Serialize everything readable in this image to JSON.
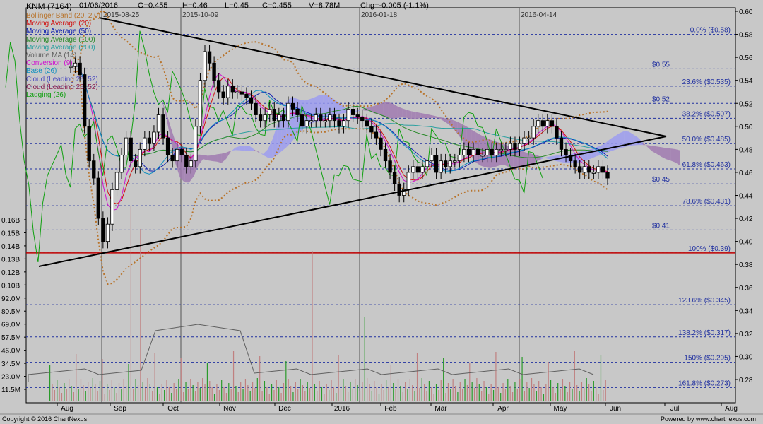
{
  "header": {
    "symbol": "KNM (7164)",
    "date": "01/06/2016",
    "open": "O=0.455",
    "high": "H=0.46",
    "low": "L=0.45",
    "close": "C=0.455",
    "volume": "V=8.78M",
    "change": "Chg=-0.005 (-1.1%)"
  },
  "legend": [
    {
      "label": "Bollinger Band (20, 2.0)",
      "color": "#b8732a"
    },
    {
      "label": "Moving Average (20)",
      "color": "#d01010"
    },
    {
      "label": "Moving Average (50)",
      "color": "#1020b0"
    },
    {
      "label": "Moving Average (100)",
      "color": "#2a8a2a"
    },
    {
      "label": "Moving Average (200)",
      "color": "#2aa0a0"
    },
    {
      "label": "Volume MA (14)",
      "color": "#606060"
    },
    {
      "label": "Conversion (9)",
      "color": "#d010d0"
    },
    {
      "label": "Base (26)",
      "color": "#1090c0"
    },
    {
      "label": "Cloud (Leading 26, 52)",
      "color": "#5050c0"
    },
    {
      "label": "Cloud (Leading 26, 52)",
      "color": "#8a2050"
    },
    {
      "label": "Lagging (26)",
      "color": "#10a010"
    }
  ],
  "footer": {
    "copyright": "Copyright © 2016 ChartNexus",
    "powered": "Powered by www.chartnexus.com"
  },
  "colors": {
    "background": "#c8c8c8",
    "candle_body": "#000000",
    "volume_up": "#2a9a2a",
    "volume_down": "#c08080",
    "support_line": "#c00000",
    "fib_line": "#2030a0",
    "cloud_bull": "#9c9cf0",
    "cloud_bear": "#a07ab0"
  },
  "chart_data": {
    "type": "candlestick",
    "price_axis": {
      "range": [
        0.265,
        0.6
      ],
      "ticks": [
        "0.60",
        "0.58",
        "0.56",
        "0.54",
        "0.52",
        "0.50",
        "0.48",
        "0.46",
        "0.44",
        "0.42",
        "0.40",
        "0.38",
        "0.36",
        "0.34",
        "0.32",
        "0.30",
        "0.28"
      ]
    },
    "volume_axis": {
      "ticks": [
        "0.16B",
        "0.15B",
        "0.14B",
        "0.13B",
        "0.12B",
        "0.10B",
        "92.0M",
        "80.5M",
        "69.0M",
        "57.5M",
        "46.0M",
        "34.5M",
        "23.0M",
        "11.5M"
      ]
    },
    "x_axis_labels": [
      "Aug",
      "Sep",
      "Oct",
      "Nov",
      "Dec",
      "2016",
      "Feb",
      "Mar",
      "Apr",
      "May",
      "Jun",
      "Jul",
      "Aug"
    ],
    "marker_dates": [
      "2015-08-25",
      "2015-10-09",
      "2016-01-18",
      "2016-04-14"
    ],
    "fibonacci_levels": [
      {
        "label": "0.0%  ($0.58)",
        "price": 0.58
      },
      {
        "label": "23.6%  ($0.535)",
        "price": 0.535
      },
      {
        "label": "38.2%  ($0.507)",
        "price": 0.507
      },
      {
        "label": "50.0%  ($0.485)",
        "price": 0.485
      },
      {
        "label": "61.8%  ($0.463)",
        "price": 0.463
      },
      {
        "label": "78.6%  ($0.431)",
        "price": 0.431
      },
      {
        "label": "100%  ($0.39)",
        "price": 0.39
      },
      {
        "label": "123.6%  ($0.345)",
        "price": 0.345
      },
      {
        "label": "138.2%  ($0.317)",
        "price": 0.317
      },
      {
        "label": "150%  ($0.295)",
        "price": 0.295
      },
      {
        "label": "161.8%  ($0.273)",
        "price": 0.273
      }
    ],
    "price_marks": [
      {
        "label": "$0.55",
        "price": 0.55
      },
      {
        "label": "$0.52",
        "price": 0.52
      },
      {
        "label": "$0.45",
        "price": 0.45
      },
      {
        "label": "$0.41",
        "price": 0.41
      }
    ],
    "support_level": 0.39,
    "closes": [
      0.552,
      0.555,
      0.545,
      0.5,
      0.47,
      0.455,
      0.42,
      0.4,
      0.415,
      0.445,
      0.46,
      0.475,
      0.49,
      0.47,
      0.465,
      0.48,
      0.49,
      0.485,
      0.495,
      0.51,
      0.49,
      0.475,
      0.47,
      0.48,
      0.475,
      0.465,
      0.47,
      0.5,
      0.54,
      0.565,
      0.555,
      0.54,
      0.53,
      0.525,
      0.535,
      0.53,
      0.53,
      0.528,
      0.525,
      0.52,
      0.51,
      0.505,
      0.51,
      0.515,
      0.505,
      0.51,
      0.505,
      0.52,
      0.515,
      0.51,
      0.5,
      0.505,
      0.505,
      0.51,
      0.505,
      0.505,
      0.51,
      0.505,
      0.5,
      0.505,
      0.515,
      0.51,
      0.508,
      0.505,
      0.5,
      0.495,
      0.49,
      0.48,
      0.47,
      0.46,
      0.45,
      0.44,
      0.445,
      0.46,
      0.465,
      0.46,
      0.465,
      0.47,
      0.475,
      0.46,
      0.47,
      0.465,
      0.47,
      0.47,
      0.475,
      0.48,
      0.475,
      0.48,
      0.475,
      0.475,
      0.48,
      0.475,
      0.48,
      0.48,
      0.48,
      0.485,
      0.48,
      0.485,
      0.49,
      0.49,
      0.5,
      0.505,
      0.5,
      0.505,
      0.5,
      0.49,
      0.48,
      0.475,
      0.47,
      0.465,
      0.46,
      0.465,
      0.46,
      0.46,
      0.465,
      0.46,
      0.455
    ]
  }
}
